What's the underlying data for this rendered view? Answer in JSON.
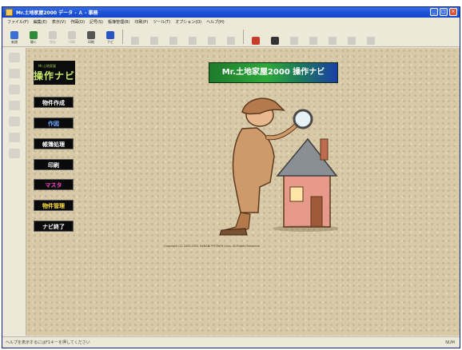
{
  "window": {
    "title": "Mr.土地家屋2000 データ - Ａ - 事務"
  },
  "menu": [
    "ファイル(F)",
    "編集(E)",
    "表示(V)",
    "作図(D)",
    "記号(S)",
    "帳簿管理(B)",
    "印刷(P)",
    "ツール(T)",
    "オプション(O)",
    "ヘルプ(H)"
  ],
  "toolbar": [
    {
      "icon": "new-file-icon",
      "label": "新規",
      "color": "#3b6fd6"
    },
    {
      "icon": "open-icon",
      "label": "開く",
      "color": "#2f8c3a"
    },
    {
      "icon": "save-icon",
      "label": "保存",
      "color": "#8a8a8a",
      "dim": true
    },
    {
      "icon": "print-icon",
      "label": "印刷",
      "color": "#8a8a8a",
      "dim": true
    },
    {
      "icon": "printer-icon",
      "label": "印刷",
      "color": "#555555"
    },
    {
      "icon": "navi-icon",
      "label": "ナビ",
      "color": "#2a53c8"
    },
    {
      "icon": "ruler-icon",
      "label": "",
      "color": "#8a8a8a",
      "dim": true
    },
    {
      "icon": "grid-icon",
      "label": "",
      "color": "#8a8a8a",
      "dim": true
    },
    {
      "icon": "layer-icon",
      "label": "",
      "color": "#8a8a8a",
      "dim": true
    },
    {
      "icon": "measure-icon",
      "label": "",
      "color": "#8a8a8a",
      "dim": true
    },
    {
      "icon": "zoom-icon",
      "label": "",
      "color": "#8a8a8a",
      "dim": true
    },
    {
      "icon": "table-icon",
      "label": "",
      "color": "#8a8a8a",
      "dim": true
    },
    {
      "icon": "house-icon",
      "label": "",
      "color": "#c83a2a"
    },
    {
      "icon": "text-icon",
      "label": "",
      "color": "#333333"
    },
    {
      "icon": "symbol-icon",
      "label": "",
      "color": "#8a8a8a",
      "dim": true
    },
    {
      "icon": "line-icon",
      "label": "",
      "color": "#8a8a8a",
      "dim": true
    },
    {
      "icon": "arc-icon",
      "label": "",
      "color": "#8a8a8a",
      "dim": true
    },
    {
      "icon": "window-icon",
      "label": "",
      "color": "#8a8a8a",
      "dim": true
    },
    {
      "icon": "option-icon",
      "label": "",
      "color": "#8a8a8a",
      "dim": true
    }
  ],
  "left_toolbar": [
    "select-icon",
    "draw-icon",
    "edit-icon",
    "zoom-icon",
    "layer-icon",
    "symbol-icon",
    "table-icon"
  ],
  "logo": {
    "small": "Mr.土地家屋",
    "main": "操作ナビ"
  },
  "nav": [
    {
      "label": "物件作成",
      "color": "#ffffff"
    },
    {
      "label": "作図",
      "color": "#6fa0ff"
    },
    {
      "label": "帳簿処理",
      "color": "#ffffff"
    },
    {
      "label": "印刷",
      "color": "#ffffff"
    },
    {
      "label": "マスタ",
      "color": "#ff4ad0"
    },
    {
      "label": "物件管理",
      "color": "#ffe040"
    },
    {
      "label": "ナビ終了",
      "color": "#ffffff"
    }
  ],
  "banner": "Mr.土地家屋2000 操作ナビ",
  "copyright": "Copyright (C) 2000-2001 HANABI PITSHEN Corp. All Rights Reserved",
  "status": {
    "left": "ヘルプを表示するにはF1キーを押してください",
    "right": "NUM"
  }
}
